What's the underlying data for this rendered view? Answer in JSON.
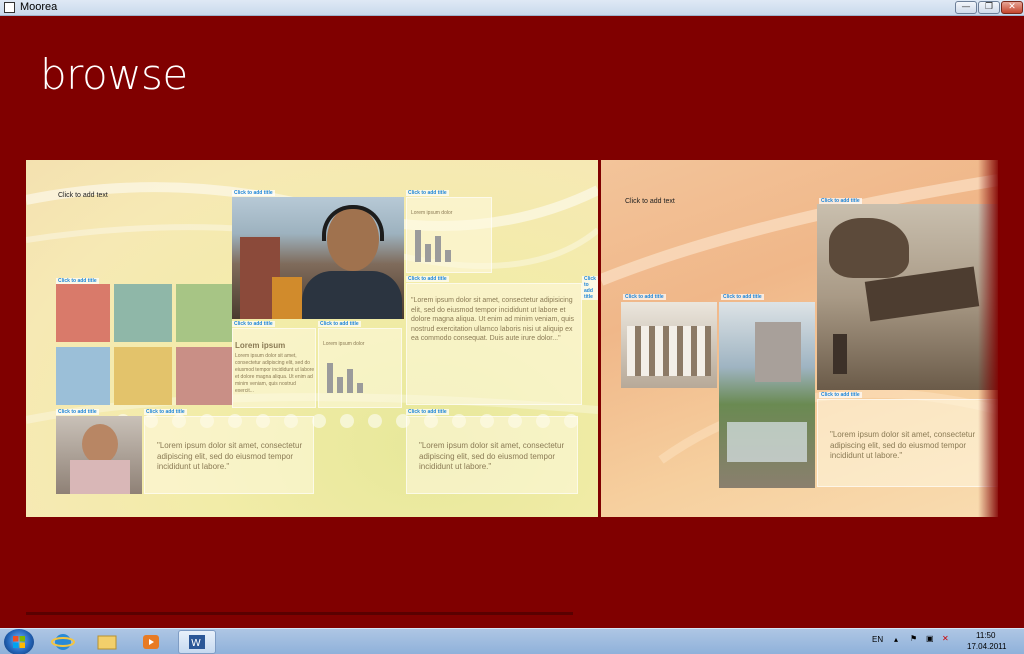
{
  "window": {
    "title": "Moorea"
  },
  "app": {
    "heading": "browse"
  },
  "slides": [
    {
      "hint": "Click to add text",
      "placeholders": {
        "photo_title": "Click to add title",
        "chart_title": "Click to add title",
        "grid_title": "Click to add title",
        "quote_title": "Click to add title",
        "small1_title": "Click to add title",
        "small2_title": "Click to add title",
        "bottom_photo_title": "Click to add title",
        "bottom_quote_title": "Click to add title",
        "bottom_right_title": "Click to add title",
        "right_edge_title": "Click to add title"
      },
      "chart_heading": "Lorem ipsum dolor",
      "quote_text": "\"Lorem ipsum dolor sit amet, consectetur adipisicing elit, sed do eiusmod tempor incididunt ut labore et dolore magna aliqua. Ut enim ad minim veniam, quis nostrud exercitation ullamco laboris nisi ut aliquip ex ea commodo consequat. Duis aute irure dolor...\"",
      "body_heading": "Lorem ipsum",
      "body_text": "Lorem ipsum dolor sit amet, consectetur adipiscing elit, sed do eiusmod tempor incididunt ut labore et dolore magna aliqua. Ut enim ad minim veniam, quis nostrud exercit...",
      "small_chart_heading": "Lorem ipsum dolor",
      "bottom_quote": "\"Lorem ipsum dolor sit amet, consectetur adipiscing elit, sed do eiusmod tempor incididunt ut labore.\"",
      "bottom_right_quote": "\"Lorem ipsum dolor sit amet, consectetur adipiscing elit, sed do eiusmod tempor incididunt ut labore.\""
    },
    {
      "hint": "Click to add text",
      "placeholders": {
        "dino_title": "Click to add title",
        "photo1_title": "Click to add title",
        "photo2_title": "Click to add title",
        "quote_title": "Click to add title"
      },
      "quote": "\"Lorem ipsum dolor sit amet, consectetur adipiscing elit, sed do eiusmod tempor incididunt ut labore.\""
    }
  ],
  "taskbar": {
    "language": "EN",
    "time": "11:50",
    "date": "17.04.2011"
  },
  "colors": {
    "background": "#800000",
    "accent": "#1f86d8"
  }
}
